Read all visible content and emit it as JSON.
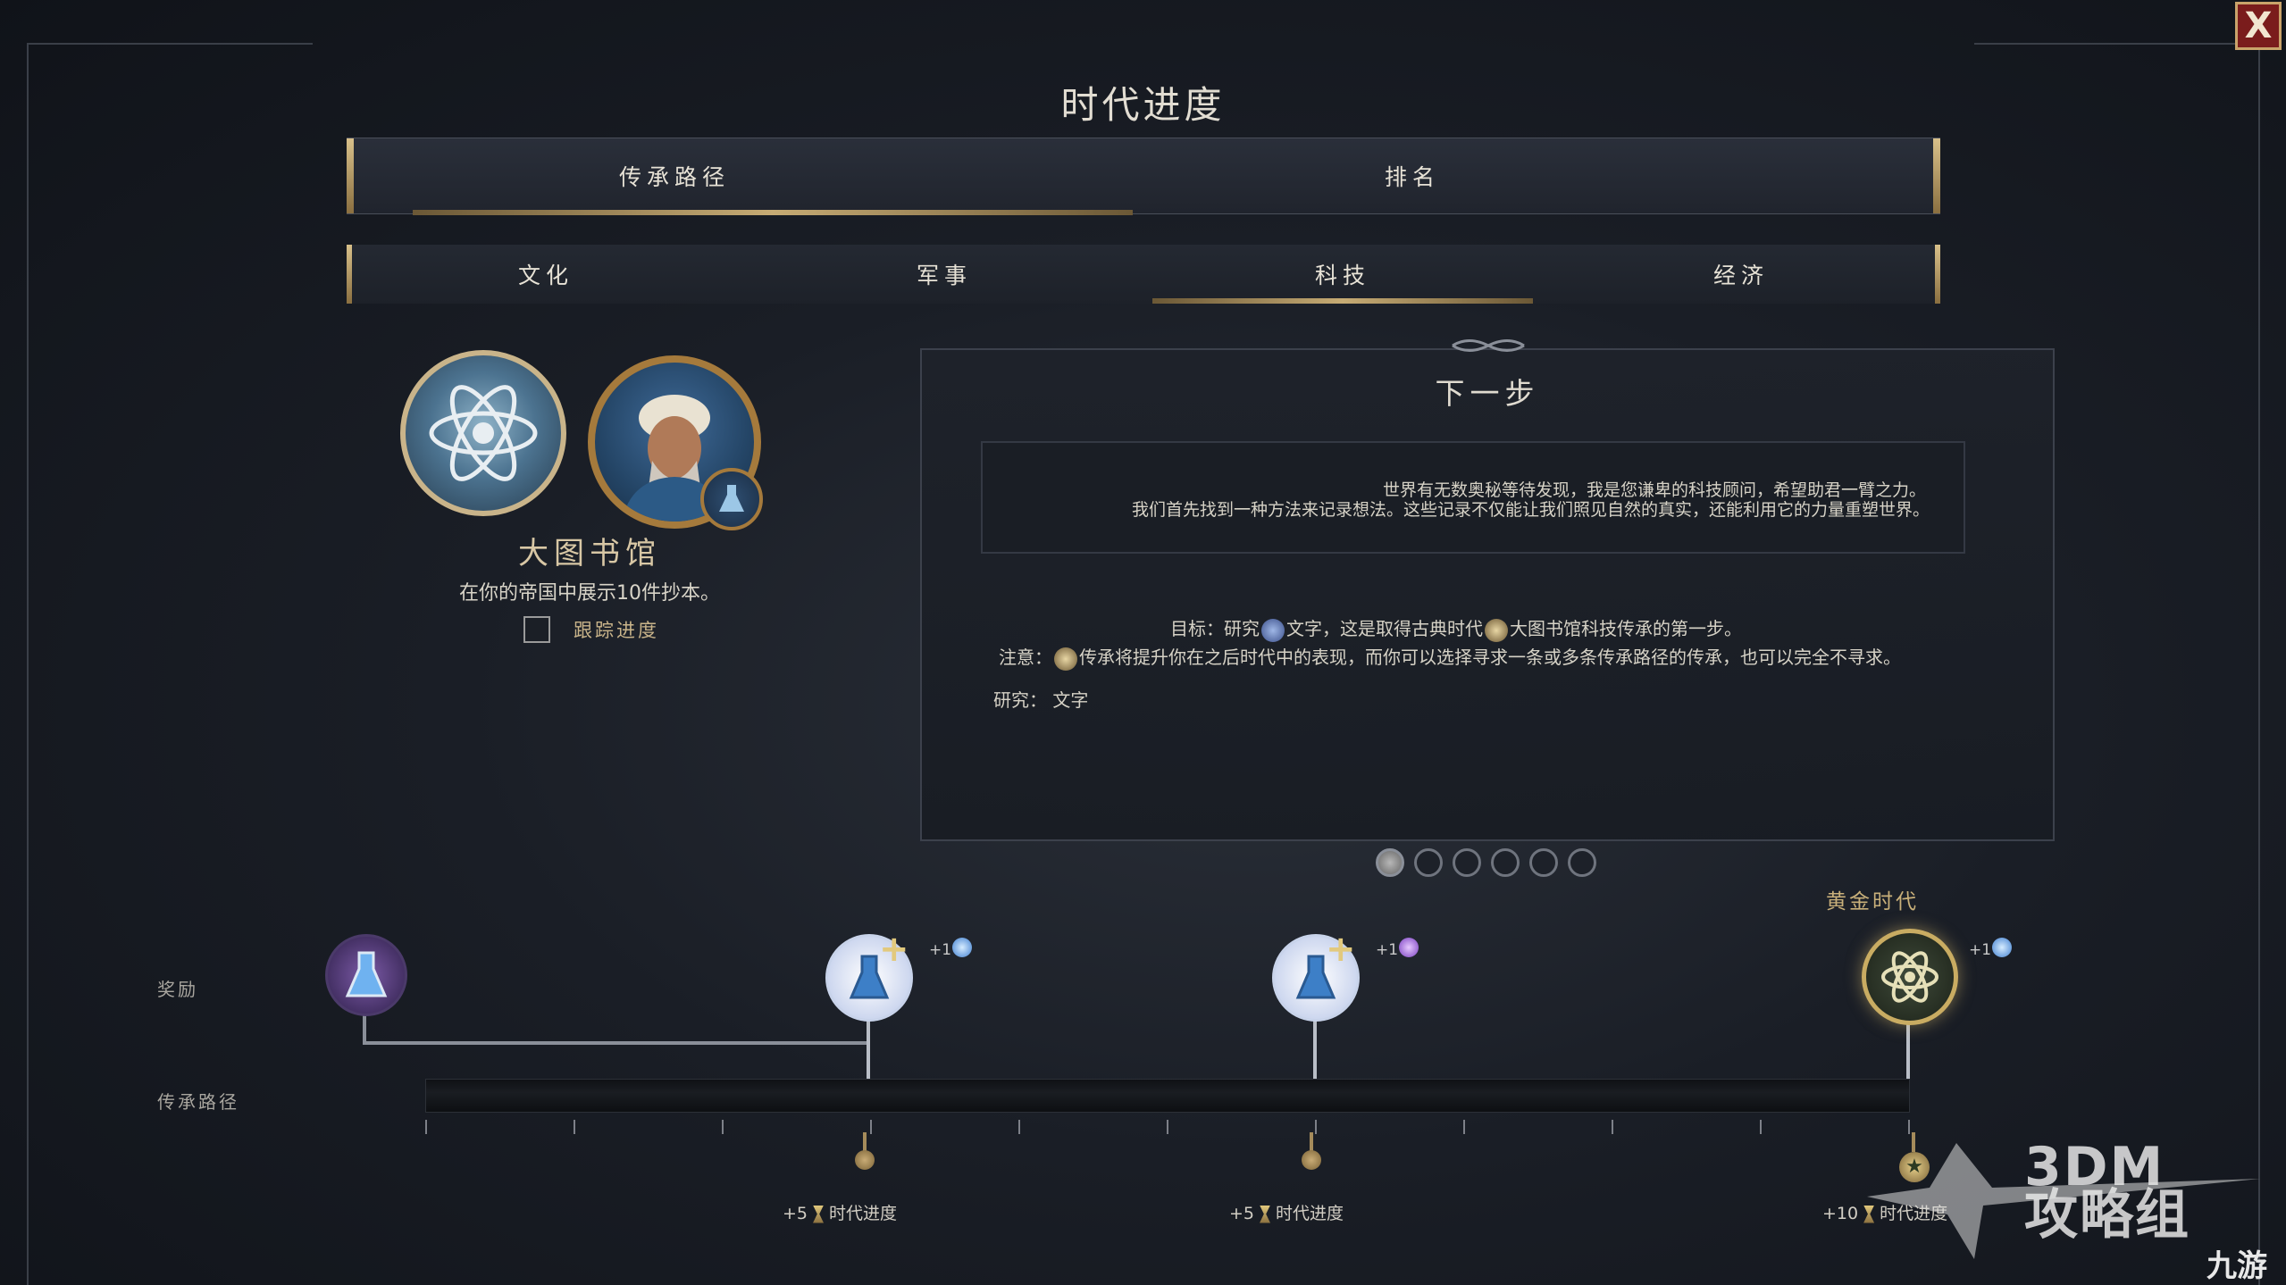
{
  "window": {
    "title": "时代进度",
    "close_label": "X"
  },
  "main_tabs": [
    {
      "label": "传承路径",
      "active": true
    },
    {
      "label": "排名",
      "active": false
    }
  ],
  "sub_tabs": [
    {
      "label": "文化",
      "active": false
    },
    {
      "label": "军事",
      "active": false
    },
    {
      "label": "科技",
      "active": true
    },
    {
      "label": "经济",
      "active": false
    }
  ],
  "legacy": {
    "name": "大图书馆",
    "description": "在你的帝国中展示10件抄本。",
    "track_label": "跟踪进度",
    "track_checked": false,
    "emblem_icon": "atom-laurel-icon",
    "advisor_icon": "science-advisor-portrait",
    "advisor_badge_icon": "flask-icon"
  },
  "next_step": {
    "heading": "下一步",
    "quote_line1": "世界有无数奥秘等待发现，我是您谦卑的科技顾问，希望助君一臂之力。",
    "quote_line2": "我们首先找到一种方法来记录想法。这些记录不仅能让我们照见自然的真实，还能利用它的力量重塑世界。",
    "goal_prefix": "目标：研究",
    "goal_tech": "文字",
    "goal_mid": "，这是取得古典时代",
    "goal_legacy": "大图书馆",
    "goal_suffix": "科技传承的第一步。",
    "note_prefix": "注意：",
    "note_text": "传承将提升你在之后时代中的表现，而你可以选择寻求一条或多条传承路径的传承，也可以完全不寻求。",
    "research_label": "研究：",
    "research_value": "文字"
  },
  "pagination": {
    "total": 6,
    "current": 1
  },
  "golden_age_label": "黄金时代",
  "rows": {
    "rewards_label": "奖励",
    "path_label": "传承路径"
  },
  "rewards": [
    {
      "icon": "science-flask-icon"
    },
    {
      "icon": "science-flask-plus-icon",
      "bonus": "+1",
      "bonus_icon": "blue-orb-icon"
    },
    {
      "icon": "science-flask-plus-icon",
      "bonus": "+1",
      "bonus_icon": "purple-orb-icon"
    },
    {
      "icon": "golden-atom-icon",
      "bonus": "+1",
      "bonus_icon": "blue-orb-icon"
    }
  ],
  "milestones": [
    {
      "amount": "+5",
      "label": "时代进度"
    },
    {
      "amount": "+5",
      "label": "时代进度"
    },
    {
      "amount": "+10",
      "label": "时代进度"
    }
  ],
  "progress": {
    "value": 0,
    "max": 10
  },
  "watermark": {
    "line1": "3DM",
    "line2": "攻略组",
    "brand": "九游"
  },
  "colors": {
    "accent_gold": "#c6ab74",
    "close_red": "#7a1c1c"
  }
}
